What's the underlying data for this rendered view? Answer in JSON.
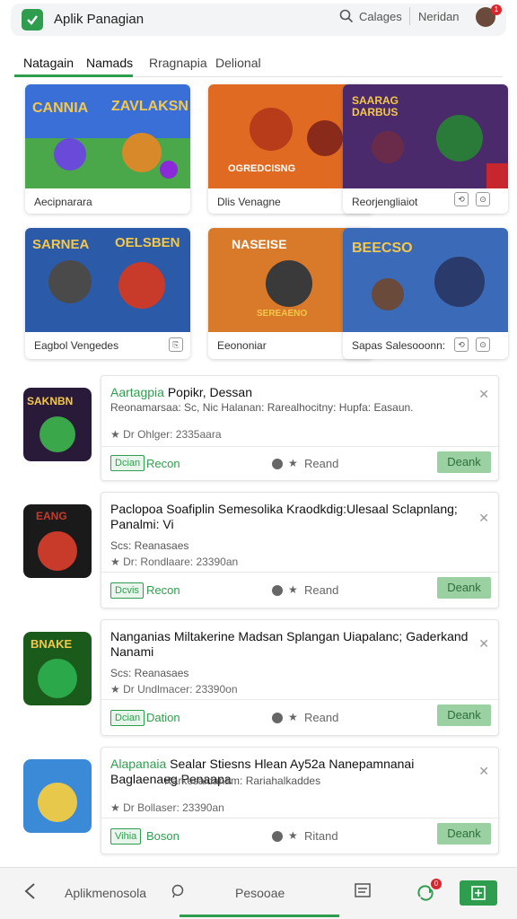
{
  "header": {
    "app_title": "Aplik Panagian",
    "search_label": "Calages",
    "user_name": "Neridan",
    "notif_count": "1"
  },
  "tabs": [
    {
      "label": "Natagain",
      "active": true
    },
    {
      "label": "Namads",
      "active": true
    },
    {
      "label": "Rragnapia",
      "active": false
    },
    {
      "label": "Delional",
      "active": false
    }
  ],
  "grid_cards": [
    {
      "caption": "Aecipnarara",
      "art_title": "CANNIA",
      "art_title2": "ZAVLAKSN",
      "colors": [
        "#3b6fd8",
        "#d88a2a"
      ]
    },
    {
      "caption": "Dlis Venagne",
      "art_title": "OGREDCISNG",
      "colors": [
        "#e06a22",
        "#b83b1a"
      ]
    },
    {
      "caption": "Reorjengliaiot",
      "art_title": "SAARAG DARBUS",
      "colors": [
        "#4a2a6a",
        "#2a7a3a"
      ]
    },
    {
      "caption": "Eagbol Vengedes",
      "art_title": "SARNEA",
      "art_title2": "OELSBEN",
      "colors": [
        "#2a5aa8",
        "#c83a2a"
      ]
    },
    {
      "caption": "Eeononiar",
      "art_title": "NASEISE",
      "art_title2": "SEREAENO",
      "colors": [
        "#d87a2a",
        "#3a3a3a"
      ]
    },
    {
      "caption": "Sapas Salesooonn:",
      "art_title": "BEECSO",
      "colors": [
        "#3a6ab8",
        "#2a3a6a"
      ]
    }
  ],
  "list_items": [
    {
      "title_hl": "Aartagpia",
      "title": "Popikr, Dessan",
      "sub": "Reonamarsaa: Sc, Nic Halanan: Rarealhocitny: Hupfa: Easaun.",
      "meta": "Dr Ohlger: 2335aara",
      "badge": "Dcian",
      "link": "Recon",
      "rating_label": "Reand",
      "button": "Deank",
      "colors": [
        "#2a1a3a",
        "#3aa84a"
      ],
      "art": "SAKNBN"
    },
    {
      "title_hl": "",
      "title": "Paclopoa Soafiplin Semesolika Kraodkdig:Ulesaal Sclapnlang; Panalmi: Vi",
      "sub": "Scs: Reanasaes",
      "meta": "Dr: Rondlaare: 23390an",
      "badge": "Dcvis",
      "link": "Recon",
      "rating_label": "Reand",
      "button": "Deank",
      "colors": [
        "#1a1a1a",
        "#c83a2a"
      ],
      "art": "EANG"
    },
    {
      "title_hl": "",
      "title": "Nanganias Miltakerine Madsan Splangan Uiapalanc; Gaderkand Nanami",
      "sub": "Scs: Reanasaes",
      "meta": "Dr Undlmacer: 23390on",
      "badge": "Dcian",
      "link": "Dation",
      "rating_label": "Reand",
      "button": "Deank",
      "colors": [
        "#1a5a1a",
        "#2aa84a"
      ],
      "art": "BNAKE"
    },
    {
      "title_hl": "Alapanaia",
      "title": "Sealar Stiesns Hlean Ay52a Nanepamnanai Baglaenaeg Penaapa",
      "sub": "Rarkesaldanam: Rariahalkaddes",
      "meta": "Dr Bollaser: 23390an",
      "badge": "Vihia",
      "link": "Boson",
      "rating_label": "Ritand",
      "button": "Deank",
      "colors": [
        "#3a8ad8",
        "#e8c84a"
      ],
      "art": ""
    }
  ],
  "bottom_nav": {
    "left_label": "Aplikmenosola",
    "center_label": "Pesooae",
    "badge": "0"
  }
}
